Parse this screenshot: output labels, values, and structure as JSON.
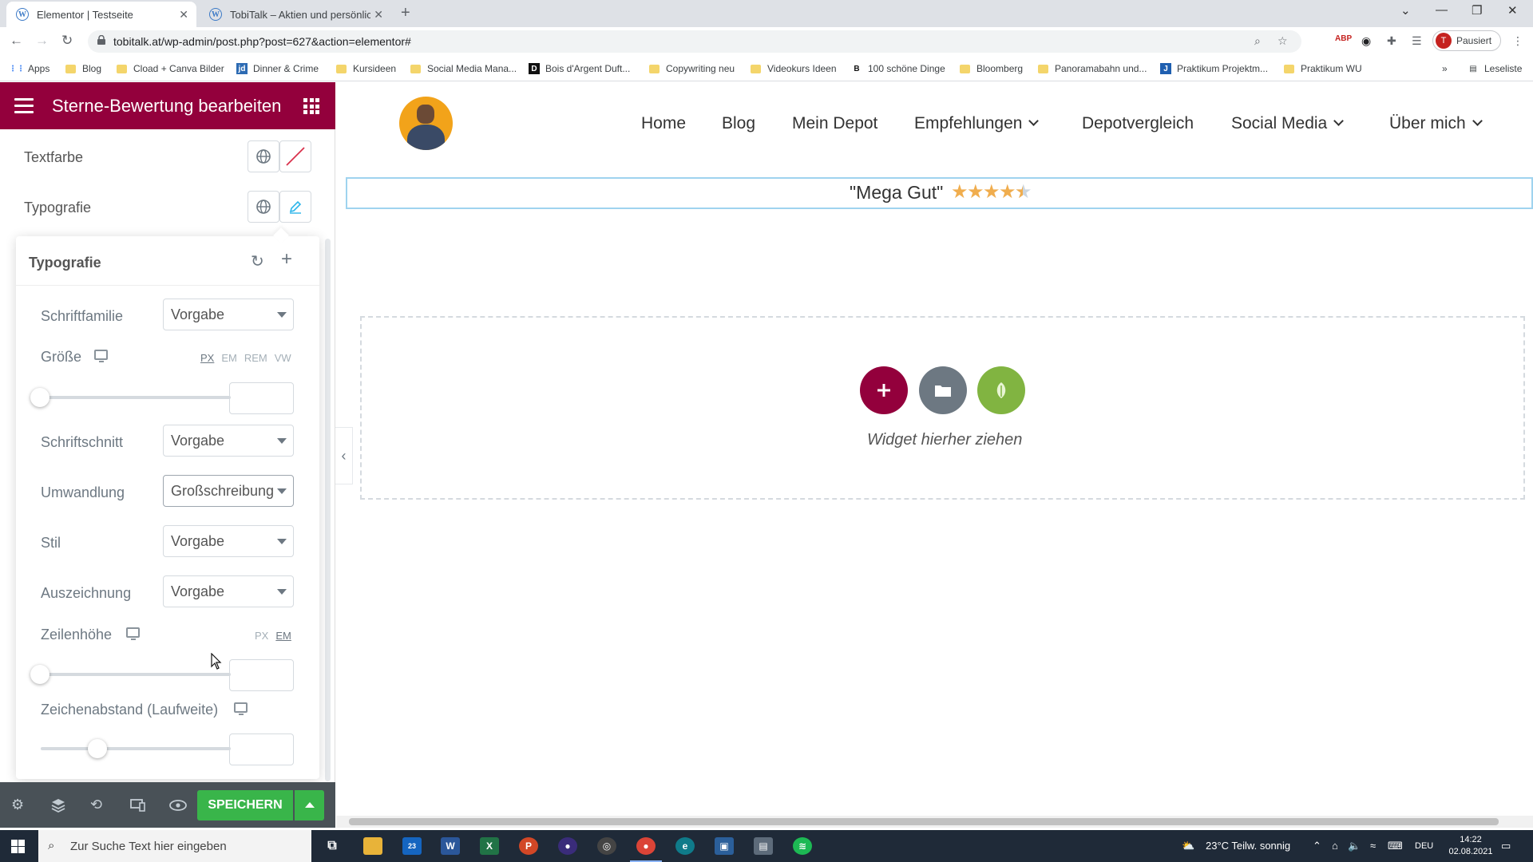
{
  "browser": {
    "tabs": [
      {
        "title": "Elementor | Testseite"
      },
      {
        "title": "TobiTalk – Aktien und persönliche"
      }
    ],
    "url": "tobitalk.at/wp-admin/post.php?post=627&action=elementor#",
    "profile_label": "Pausiert",
    "profile_initial": "T",
    "bookmarks": [
      "Apps",
      "Blog",
      "Cload + Canva Bilder",
      "Dinner & Crime",
      "Kursideen",
      "Social Media Mana...",
      "Bois d'Argent Duft...",
      "Copywriting neu",
      "Videokurs Ideen",
      "100 schöne Dinge",
      "Bloomberg",
      "Panoramabahn und...",
      "Praktikum Projektm...",
      "Praktikum WU"
    ],
    "bookmarks_more": "»",
    "reading_list": "Leseliste"
  },
  "panel": {
    "title": "Sterne-Bewertung bearbeiten",
    "text_color_label": "Textfarbe",
    "typography_label": "Typografie",
    "popover": {
      "title": "Typografie",
      "font_family": {
        "label": "Schriftfamilie",
        "value": "Vorgabe"
      },
      "size": {
        "label": "Größe",
        "units": [
          "PX",
          "EM",
          "REM",
          "VW"
        ],
        "active_unit": "PX"
      },
      "weight": {
        "label": "Schriftschnitt",
        "value": "Vorgabe"
      },
      "transform": {
        "label": "Umwandlung",
        "value": "Großschreibung"
      },
      "style": {
        "label": "Stil",
        "value": "Vorgabe"
      },
      "decoration": {
        "label": "Auszeichnung",
        "value": "Vorgabe"
      },
      "line_height": {
        "label": "Zeilenhöhe",
        "units": [
          "PX",
          "EM"
        ],
        "active_unit": "EM"
      },
      "letter_spacing": {
        "label": "Zeichenabstand (Laufweite)"
      }
    },
    "footer": {
      "save_label": "SPEICHERN"
    }
  },
  "preview": {
    "menu": [
      "Home",
      "Blog",
      "Mein Depot",
      "Empfehlungen",
      "Depotvergleich",
      "Social Media",
      "Über mich"
    ],
    "rating_text": "\"Mega Gut\"",
    "rating_value": 4.5,
    "rating_max": 5,
    "dropzone_text": "Widget hierher ziehen"
  },
  "taskbar": {
    "search_placeholder": "Zur Suche Text hier eingeben",
    "mail_badge": "23",
    "weather": "23°C  Teilw. sonnig",
    "language": "DEU",
    "time": "14:22",
    "date": "02.08.2021"
  },
  "colors": {
    "panel_header": "#93003c",
    "save_button": "#39b54a",
    "add_button": "#93003c",
    "folder_button": "#6d7882",
    "elementor_kit_button": "#81b441",
    "star": "#f0ad4e"
  }
}
